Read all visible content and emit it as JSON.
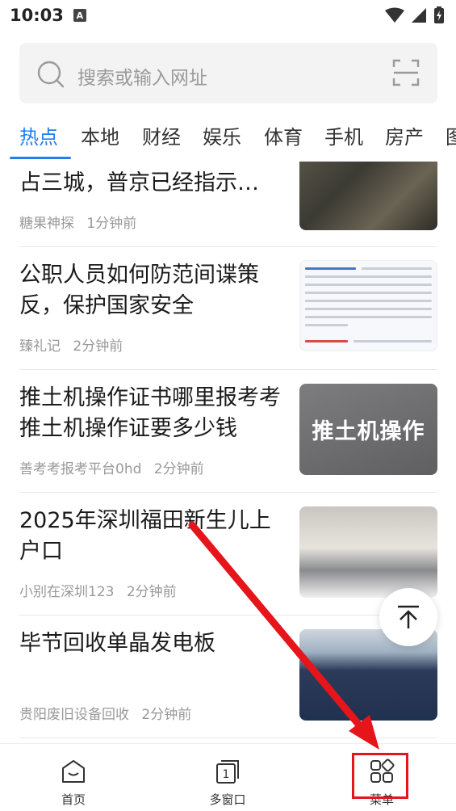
{
  "status_bar": {
    "time": "10:03",
    "notification_icon": "A"
  },
  "search": {
    "placeholder": "搜索或输入网址"
  },
  "tabs": [
    {
      "label": "热点",
      "active": true
    },
    {
      "label": "本地"
    },
    {
      "label": "财经"
    },
    {
      "label": "娱乐"
    },
    {
      "label": "体育"
    },
    {
      "label": "手机"
    },
    {
      "label": "房产"
    },
    {
      "label": "图"
    }
  ],
  "feed": [
    {
      "title": "占三城，普京已经指示…",
      "source": "糖果神探",
      "time": "1分钟前"
    },
    {
      "title": "公职人员如何防范间谍策反，保护国家安全",
      "source": "臻礼记",
      "time": "2分钟前"
    },
    {
      "title": "推土机操作证书哪里报考考推土机操作证要多少钱",
      "source": "善考考报考平台0hd",
      "time": "2分钟前",
      "thumb_text": "推土机操作"
    },
    {
      "title": "2025年深圳福田新生儿上户口",
      "source": "小别在深圳123",
      "time": "2分钟前"
    },
    {
      "title": "毕节回收单晶发电板",
      "source": "贵阳废旧设备回收",
      "time": "2分钟前"
    }
  ],
  "bottom_nav": {
    "home": "首页",
    "windows": "多窗口",
    "windows_count": "1",
    "menu": "菜单"
  },
  "colors": {
    "accent": "#1f7ff0",
    "annotation": "#e5151b"
  }
}
